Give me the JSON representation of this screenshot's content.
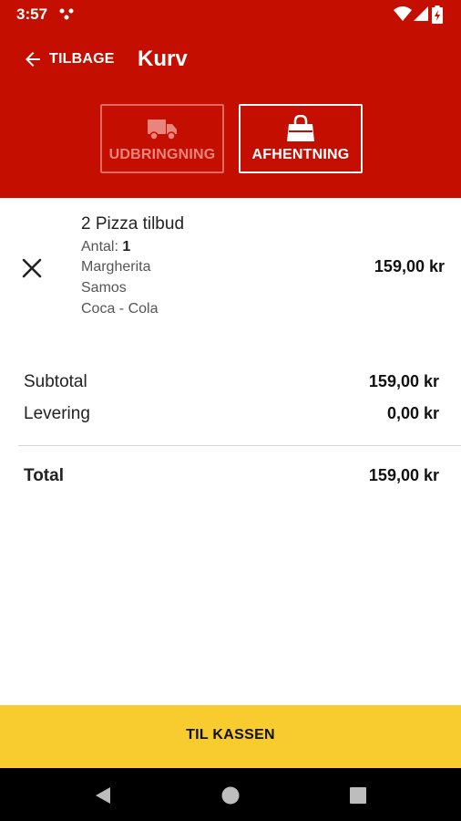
{
  "status_bar": {
    "time": "3:57",
    "icons": [
      "app-notification-icon",
      "wifi-icon",
      "signal-icon",
      "battery-charging-icon"
    ]
  },
  "toolbar": {
    "back_label": "TILBAGE",
    "title": "Kurv"
  },
  "order_mode": {
    "delivery_label": "UDBRINGNING",
    "pickup_label": "AFHENTNING",
    "selected": "pickup",
    "delivery_icon": "truck-icon",
    "pickup_icon": "shopping-bag-icon"
  },
  "cart": {
    "items": [
      {
        "name": "2 Pizza tilbud",
        "quantity_label": "Antal:",
        "quantity": "1",
        "options": [
          "Margherita",
          "Samos",
          "Coca - Cola"
        ],
        "price": "159,00 kr"
      }
    ]
  },
  "summary": {
    "subtotal_label": "Subtotal",
    "subtotal_value": "159,00 kr",
    "delivery_label": "Levering",
    "delivery_value": "0,00 kr",
    "total_label": "Total",
    "total_value": "159,00 kr"
  },
  "checkout": {
    "label": "TIL KASSEN"
  },
  "colors": {
    "header": "#c40f00",
    "checkout": "#f8cb2e",
    "nav_bar": "#000000"
  }
}
